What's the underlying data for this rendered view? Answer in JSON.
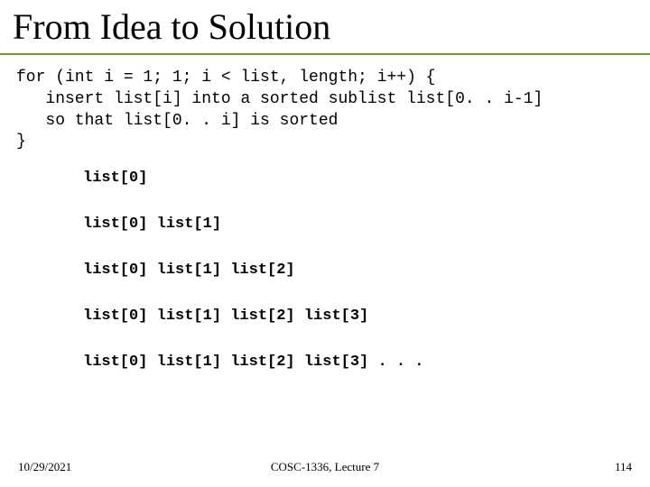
{
  "title": "From Idea to Solution",
  "code": "for (int i = 1; 1; i < list, length; i++) {\n   insert list[i] into a sorted sublist list[0. . i-1]\n   so that list[0. . i] is sorted\n}",
  "lists": [
    "list[0]",
    "list[0] list[1]",
    "list[0] list[1] list[2]",
    "list[0] list[1] list[2] list[3]",
    "list[0] list[1] list[2] list[3] . . ."
  ],
  "footer": {
    "date": "10/29/2021",
    "course": "COSC-1336, Lecture 7",
    "page": "114"
  }
}
